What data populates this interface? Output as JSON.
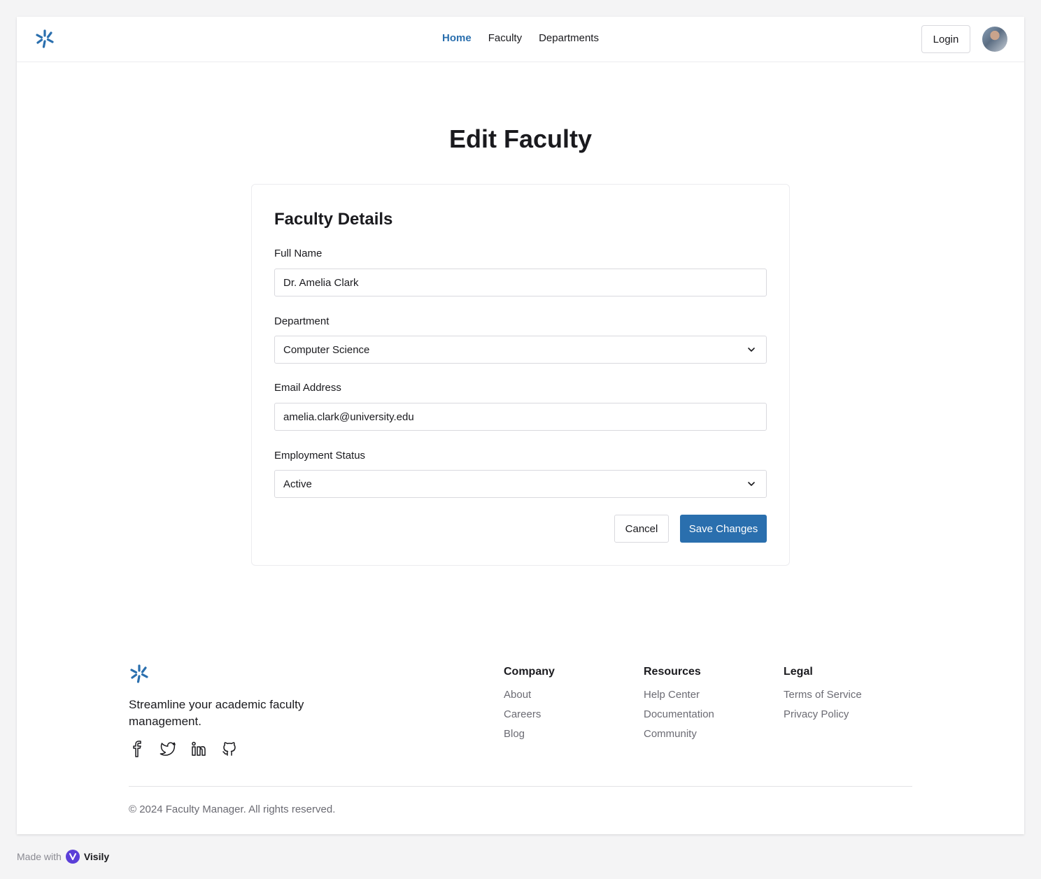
{
  "header": {
    "nav": [
      {
        "label": "Home",
        "active": true
      },
      {
        "label": "Faculty",
        "active": false
      },
      {
        "label": "Departments",
        "active": false
      }
    ],
    "login_label": "Login"
  },
  "main": {
    "title": "Edit Faculty",
    "card": {
      "title": "Faculty Details",
      "fields": {
        "full_name": {
          "label": "Full Name",
          "value": "Dr. Amelia Clark"
        },
        "department": {
          "label": "Department",
          "value": "Computer Science"
        },
        "email": {
          "label": "Email Address",
          "value": "amelia.clark@university.edu"
        },
        "status": {
          "label": "Employment Status",
          "value": "Active"
        }
      },
      "cancel_label": "Cancel",
      "save_label": "Save Changes"
    }
  },
  "footer": {
    "tagline": "Streamline your academic faculty management.",
    "socials": [
      "facebook-icon",
      "twitter-icon",
      "linkedin-icon",
      "github-icon"
    ],
    "columns": [
      {
        "title": "Company",
        "links": [
          "About",
          "Careers",
          "Blog"
        ]
      },
      {
        "title": "Resources",
        "links": [
          "Help Center",
          "Documentation",
          "Community"
        ]
      },
      {
        "title": "Legal",
        "links": [
          "Terms of Service",
          "Privacy Policy"
        ]
      }
    ],
    "copyright": "© 2024 Faculty Manager. All rights reserved."
  },
  "made_with": {
    "prefix": "Made with",
    "brand": "Visily"
  },
  "colors": {
    "accent": "#2a6fae",
    "text": "#1a1a1e",
    "muted": "#6b6b73"
  }
}
